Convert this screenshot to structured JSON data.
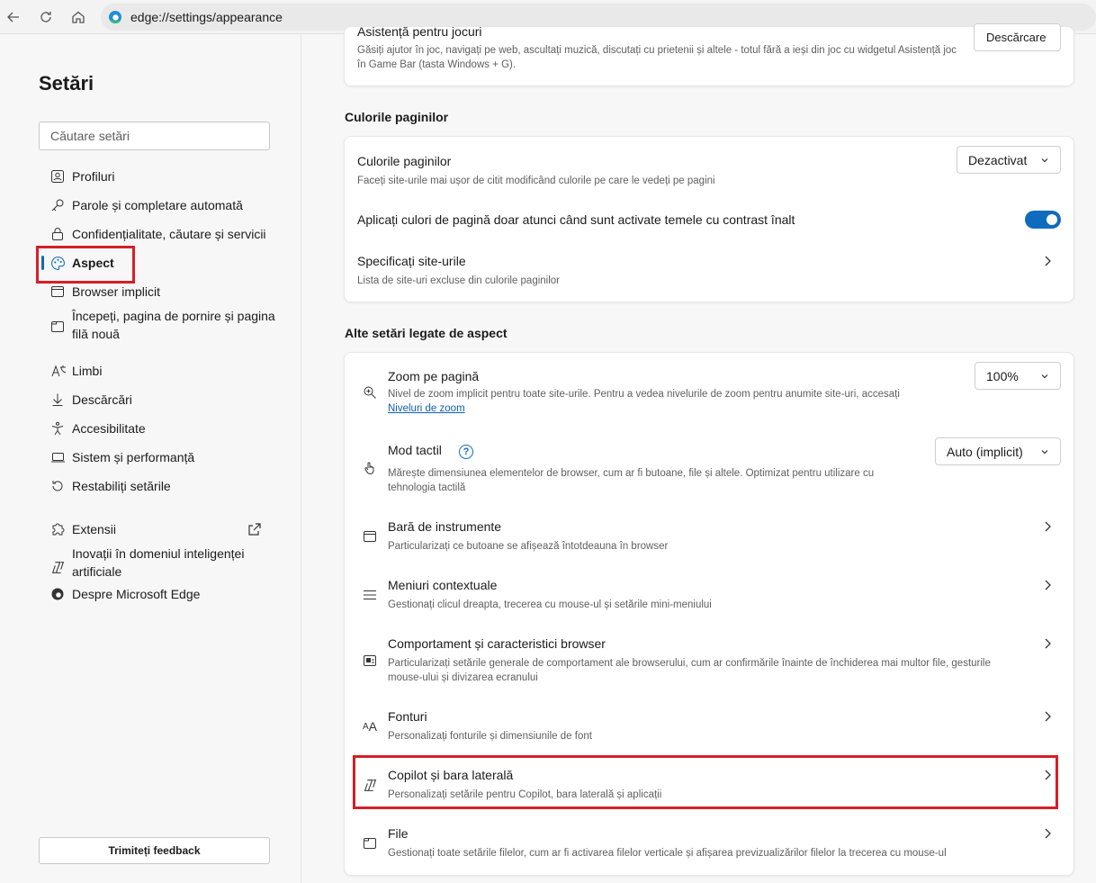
{
  "browser": {
    "url": "edge://settings/appearance"
  },
  "sidebar": {
    "title": "Setări",
    "search_placeholder": "Căutare setări",
    "items": [
      {
        "label": "Profiluri",
        "icon": "profile-icon"
      },
      {
        "label": "Parole și completare automată",
        "icon": "key-icon"
      },
      {
        "label": "Confidențialitate, căutare și servicii",
        "icon": "lock-icon"
      },
      {
        "label": "Aspect",
        "icon": "palette-icon",
        "active": true
      },
      {
        "label": "Browser implicit",
        "icon": "browser-icon"
      },
      {
        "label": "Începeți, pagina de pornire și pagina filă nouă",
        "icon": "home-tab-icon"
      },
      {
        "label": "Limbi",
        "icon": "language-icon"
      },
      {
        "label": "Descărcări",
        "icon": "download-icon"
      },
      {
        "label": "Accesibilitate",
        "icon": "accessibility-icon"
      },
      {
        "label": "Sistem și performanță",
        "icon": "laptop-icon"
      },
      {
        "label": "Restabiliți setările",
        "icon": "reset-icon"
      },
      {
        "label": "Extensii",
        "icon": "puzzle-icon"
      },
      {
        "label": "Inovații în domeniul inteligenței artificiale",
        "icon": "copilot-icon"
      },
      {
        "label": "Despre Microsoft Edge",
        "icon": "edge-icon"
      }
    ],
    "feedback_label": "Trimiteți feedback"
  },
  "main": {
    "top_partial": {
      "title": "Asistență pentru jocuri",
      "desc": "Găsiți ajutor în joc, navigați pe web, ascultați muzică, discutați cu prietenii și altele - totul fără a ieși din joc cu widgetul Asistență joc în Game Bar (tasta Windows + G).",
      "button": "Descărcare"
    },
    "page_colors": {
      "section_title": "Culorile paginilor",
      "row1_title": "Culorile paginilor",
      "row1_desc": "Faceți site-urile mai ușor de citit modificând culorile pe care le vedeți pe pagini",
      "row1_value": "Dezactivat",
      "row2_title": "Aplicați culori de pagină doar atunci când sunt activate temele cu contrast înalt",
      "row2_on": true,
      "row3_title": "Specificați site-urile",
      "row3_desc": "Lista de site-uri excluse din culorile paginilor"
    },
    "other": {
      "section_title": "Alte setări legate de aspect",
      "zoom_title": "Zoom pe pagină",
      "zoom_desc": "Nivel de zoom implicit pentru toate site-urile. Pentru a vedea nivelurile de zoom pentru anumite site-uri, accesați",
      "zoom_link": "Niveluri de zoom",
      "zoom_value": "100%",
      "touch_title": "Mod tactil",
      "touch_desc": "Mărește dimensiunea elementelor de browser, cum ar fi butoane, file și altele. Optimizat pentru utilizare cu tehnologia tactilă",
      "touch_value": "Auto (implicit)",
      "toolbar_title": "Bară de instrumente",
      "toolbar_desc": "Particularizați ce butoane se afișează întotdeauna în browser",
      "context_title": "Meniuri contextuale",
      "context_desc": "Gestionați clicul dreapta, trecerea cu mouse-ul și setările mini-meniului",
      "behavior_title": "Comportament și caracteristici browser",
      "behavior_desc": "Particularizați setările generale de comportament ale browserului, cum ar confirmările înainte de închiderea mai multor file, gesturile mouse-ului și divizarea ecranului",
      "fonts_title": "Fonturi",
      "fonts_desc": "Personalizați fonturile și dimensiunile de font",
      "copilot_title": "Copilot și bara laterală",
      "copilot_desc": "Personalizați setările pentru Copilot, bara laterală și aplicații",
      "files_title": "File",
      "files_desc": "Gestionați toate setările filelor, cum ar fi activarea filelor verticale și afișarea previzualizărilor filelor la trecerea cu mouse-ul"
    }
  },
  "colors": {
    "accent": "#0f6cbd",
    "highlight_box": "#d42026"
  }
}
